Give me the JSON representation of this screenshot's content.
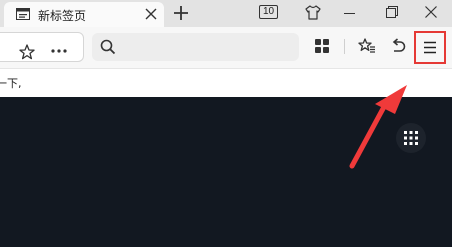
{
  "tab": {
    "title": "新标签页"
  },
  "titlebar": {
    "tab_count": "10"
  },
  "search": {
    "placeholder": ""
  },
  "bookmarks": {
    "text": "一下,"
  },
  "colors": {
    "highlight": "#e53935",
    "dark_background": "#121821"
  },
  "icons": [
    "page-icon",
    "close-icon",
    "plus-icon",
    "tshirt-icon",
    "minimize-icon",
    "restore-icon",
    "window-close-icon",
    "star-icon",
    "more-icon",
    "search-icon",
    "apps-grid-icon",
    "favorites-icon",
    "undo-icon",
    "menu-icon",
    "dots-grid-icon"
  ]
}
